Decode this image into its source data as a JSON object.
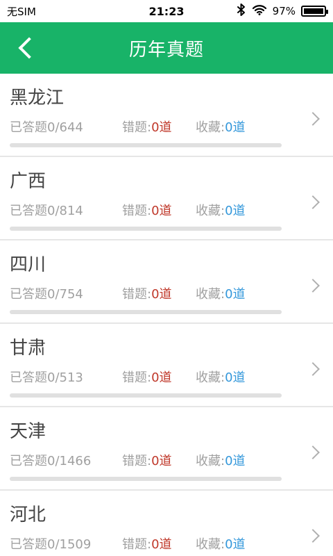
{
  "status_bar": {
    "carrier": "无SIM",
    "time": "21:23",
    "battery_percent": "97%",
    "icons": [
      "bluetooth-icon",
      "wifi-icon",
      "battery-icon"
    ]
  },
  "header": {
    "title": "历年真题",
    "background": "#18b368",
    "back_icon": "chevron-left-icon"
  },
  "labels": {
    "answered_prefix": "已答题",
    "wrong_label": "错题:",
    "fav_label": "收藏:",
    "unit": "道"
  },
  "items": [
    {
      "name": "黑龙江",
      "answered": "0/644",
      "wrong": "0",
      "fav": "0",
      "progress": 0
    },
    {
      "name": "广西",
      "answered": "0/814",
      "wrong": "0",
      "fav": "0",
      "progress": 0
    },
    {
      "name": "四川",
      "answered": "0/754",
      "wrong": "0",
      "fav": "0",
      "progress": 0
    },
    {
      "name": "甘肃",
      "answered": "0/513",
      "wrong": "0",
      "fav": "0",
      "progress": 0
    },
    {
      "name": "天津",
      "answered": "0/1466",
      "wrong": "0",
      "fav": "0",
      "progress": 0
    },
    {
      "name": "河北",
      "answered": "0/1509",
      "wrong": "0",
      "fav": "0",
      "progress": 0
    }
  ]
}
